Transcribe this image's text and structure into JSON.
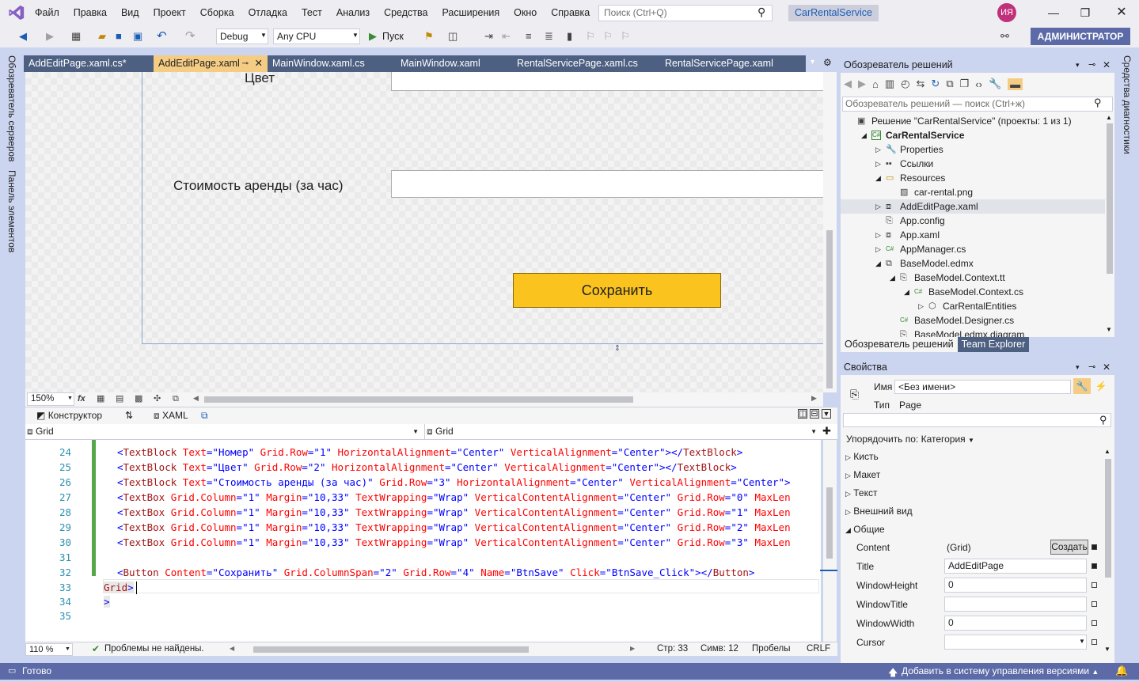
{
  "menu": [
    "Файл",
    "Правка",
    "Вид",
    "Проект",
    "Сборка",
    "Отладка",
    "Тест",
    "Анализ",
    "Средства",
    "Расширения",
    "Окно",
    "Справка"
  ],
  "search": {
    "placeholder": "Поиск (Ctrl+Q)"
  },
  "app_name": "CarRentalService",
  "user_initials": "ИЯ",
  "toolbar": {
    "config": "Debug",
    "platform": "Any CPU",
    "run_label": "Пуск"
  },
  "admin_label": "АДМИНИСТРАТОР",
  "left_rail": [
    "Обозреватель серверов",
    "Панель элементов"
  ],
  "right_rail": [
    "Средства диагностики"
  ],
  "doc_tabs": [
    {
      "label": "AddEditPage.xaml.cs*",
      "active": false
    },
    {
      "label": "AddEditPage.xaml",
      "active": true
    },
    {
      "label": "MainWindow.xaml.cs",
      "active": false
    },
    {
      "label": "MainWindow.xaml",
      "active": false
    },
    {
      "label": "RentalServicePage.xaml.cs",
      "active": false
    },
    {
      "label": "RentalServicePage.xaml",
      "active": false
    }
  ],
  "designer": {
    "label_color": "Цвет",
    "label_cost": "Стоимость аренды (за час)",
    "save_button": "Сохранить",
    "zoom": "150%"
  },
  "split_tabs": {
    "designer": "Конструктор",
    "xaml": "XAML"
  },
  "nav_bar": {
    "left": "Grid",
    "right": "Grid"
  },
  "code_lines": [
    {
      "num": "24",
      "text": "<TextBlock Text=\"Номер\" Grid.Row=\"1\" HorizontalAlignment=\"Center\" VerticalAlignment=\"Center\"></TextBlock>"
    },
    {
      "num": "25",
      "text": "<TextBlock Text=\"Цвет\" Grid.Row=\"2\" HorizontalAlignment=\"Center\" VerticalAlignment=\"Center\"></TextBlock>"
    },
    {
      "num": "26",
      "text": "<TextBlock Text=\"Стоимость аренды (за час)\" Grid.Row=\"3\" HorizontalAlignment=\"Center\" VerticalAlignment=\"Center\">"
    },
    {
      "num": "27",
      "text": "<TextBox Grid.Column=\"1\" Margin=\"10,33\" TextWrapping=\"Wrap\" VerticalContentAlignment=\"Center\" Grid.Row=\"0\" MaxLen"
    },
    {
      "num": "28",
      "text": "<TextBox Grid.Column=\"1\" Margin=\"10,33\" TextWrapping=\"Wrap\" VerticalContentAlignment=\"Center\" Grid.Row=\"1\" MaxLen"
    },
    {
      "num": "29",
      "text": "<TextBox Grid.Column=\"1\" Margin=\"10,33\" TextWrapping=\"Wrap\" VerticalContentAlignment=\"Center\" Grid.Row=\"2\" MaxLen"
    },
    {
      "num": "30",
      "text": "<TextBox Grid.Column=\"1\" Margin=\"10,33\" TextWrapping=\"Wrap\" VerticalContentAlignment=\"Center\" Grid.Row=\"3\" MaxLen"
    },
    {
      "num": "31",
      "text": ""
    },
    {
      "num": "32",
      "text": "<Button Content=\"Сохранить\" Grid.ColumnSpan=\"2\" Grid.Row=\"4\" Name=\"BtnSave\" Click=\"BtnSave_Click\"></Button>"
    },
    {
      "num": "33",
      "text": "Grid>"
    },
    {
      "num": "34",
      "text": ">"
    },
    {
      "num": "35",
      "text": ""
    }
  ],
  "editor_status": {
    "zoom": "110 %",
    "problems": "Проблемы не найдены.",
    "line": "Стр: 33",
    "col": "Симв: 12",
    "spaces": "Пробелы",
    "eol": "CRLF"
  },
  "status_bar": {
    "ready": "Готово",
    "vcs": "Добавить в систему управления версиями"
  },
  "solution_explorer": {
    "title": "Обозреватель решений",
    "search_placeholder": "Обозреватель решений — поиск (Ctrl+ж)",
    "items": [
      {
        "label": "Решение \"CarRentalService\" (проекты: 1 из 1)",
        "indent": 0,
        "expander": "",
        "icon": "solution-icon"
      },
      {
        "label": "CarRentalService",
        "indent": 1,
        "expander": "◢",
        "icon": "csharp-project-icon",
        "bold": true
      },
      {
        "label": "Properties",
        "indent": 2,
        "expander": "▷",
        "icon": "wrench-icon"
      },
      {
        "label": "Ссылки",
        "indent": 2,
        "expander": "▷",
        "icon": "references-icon"
      },
      {
        "label": "Resources",
        "indent": 2,
        "expander": "◢",
        "icon": "folder-icon"
      },
      {
        "label": "car-rental.png",
        "indent": 3,
        "expander": "",
        "icon": "image-file-icon"
      },
      {
        "label": "AddEditPage.xaml",
        "indent": 2,
        "expander": "▷",
        "icon": "xaml-file-icon",
        "selected": true
      },
      {
        "label": "App.config",
        "indent": 2,
        "expander": "",
        "icon": "config-file-icon"
      },
      {
        "label": "App.xaml",
        "indent": 2,
        "expander": "▷",
        "icon": "xaml-file-icon"
      },
      {
        "label": "AppManager.cs",
        "indent": 2,
        "expander": "▷",
        "icon": "csharp-file-icon"
      },
      {
        "label": "BaseModel.edmx",
        "indent": 2,
        "expander": "◢",
        "icon": "edmx-file-icon"
      },
      {
        "label": "BaseModel.Context.tt",
        "indent": 3,
        "expander": "◢",
        "icon": "tt-file-icon"
      },
      {
        "label": "BaseModel.Context.cs",
        "indent": 4,
        "expander": "◢",
        "icon": "csharp-file-icon"
      },
      {
        "label": "CarRentalEntities",
        "indent": 5,
        "expander": "▷",
        "icon": "class-icon"
      },
      {
        "label": "BaseModel.Designer.cs",
        "indent": 3,
        "expander": "",
        "icon": "csharp-file-icon"
      },
      {
        "label": "BaseModel.edmx.diagram",
        "indent": 3,
        "expander": "",
        "icon": "file-icon"
      }
    ],
    "bottom_tabs": [
      "Обозреватель решений",
      "Team Explorer"
    ]
  },
  "properties": {
    "title": "Свойства",
    "name_label": "Имя",
    "name_value": "<Без имени>",
    "type_label": "Тип",
    "type_value": "Page",
    "sort_label": "Упорядочить по: Категория",
    "categories": [
      "Кисть",
      "Макет",
      "Текст",
      "Внешний вид",
      "Общие"
    ],
    "rows": [
      {
        "name": "Content",
        "value": "(Grid)",
        "button": "Создать"
      },
      {
        "name": "Title",
        "value": "AddEditPage"
      },
      {
        "name": "WindowHeight",
        "value": "0"
      },
      {
        "name": "WindowTitle",
        "value": ""
      },
      {
        "name": "WindowWidth",
        "value": "0"
      },
      {
        "name": "Cursor",
        "value": ""
      }
    ]
  },
  "colors": {
    "accent": "#5C6BA8",
    "save_button": "#FBC31E",
    "active_tab": "#F5CC84"
  }
}
